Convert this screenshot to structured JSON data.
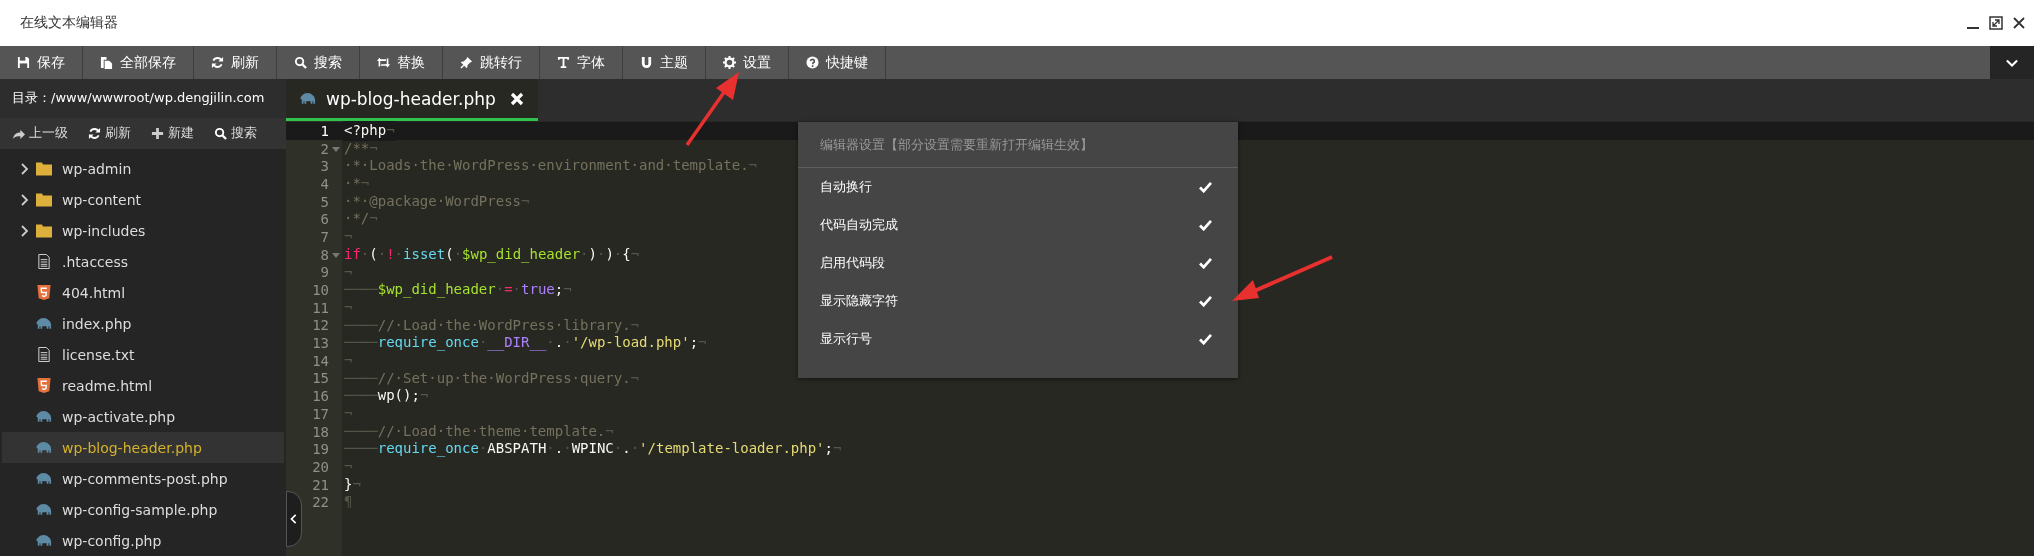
{
  "window": {
    "title": "在线文本编辑器"
  },
  "toolbar": [
    "保存",
    "全部保存",
    "刷新",
    "搜索",
    "替换",
    "跳转行",
    "字体",
    "主题",
    "设置",
    "快捷键"
  ],
  "sidebar": {
    "path": "目录：/www/wwwroot/wp.dengjilin.com",
    "tools": [
      "上一级",
      "刷新",
      "新建",
      "搜索"
    ],
    "files": [
      {
        "name": "wp-admin",
        "kind": "folder",
        "selected": false
      },
      {
        "name": "wp-content",
        "kind": "folder",
        "selected": false
      },
      {
        "name": "wp-includes",
        "kind": "folder",
        "selected": false
      },
      {
        "name": ".htaccess",
        "kind": "text",
        "selected": false
      },
      {
        "name": "404.html",
        "kind": "html",
        "selected": false
      },
      {
        "name": "index.php",
        "kind": "php",
        "selected": false
      },
      {
        "name": "license.txt",
        "kind": "text",
        "selected": false
      },
      {
        "name": "readme.html",
        "kind": "html",
        "selected": false
      },
      {
        "name": "wp-activate.php",
        "kind": "php",
        "selected": false
      },
      {
        "name": "wp-blog-header.php",
        "kind": "php",
        "selected": true
      },
      {
        "name": "wp-comments-post.php",
        "kind": "php",
        "selected": false
      },
      {
        "name": "wp-config-sample.php",
        "kind": "php",
        "selected": false
      },
      {
        "name": "wp-config.php",
        "kind": "php",
        "selected": false
      }
    ]
  },
  "tabs": [
    {
      "label": "wp-blog-header.php",
      "selected": true
    }
  ],
  "editor": {
    "lines": [
      {
        "n": "1",
        "current": true,
        "foldable": false,
        "tokens": [
          {
            "kind": "plain",
            "text": "<?php"
          },
          {
            "kind": "inv",
            "text": "¬"
          }
        ]
      },
      {
        "n": "2",
        "current": false,
        "foldable": true,
        "tokens": [
          {
            "kind": "comment",
            "text": "/**"
          },
          {
            "kind": "inv",
            "text": "¬"
          }
        ]
      },
      {
        "n": "3",
        "current": false,
        "foldable": false,
        "tokens": [
          {
            "kind": "comment",
            "text": "·*·Loads·the·WordPress·environment·and·template."
          },
          {
            "kind": "inv",
            "text": "¬"
          }
        ]
      },
      {
        "n": "4",
        "current": false,
        "foldable": false,
        "tokens": [
          {
            "kind": "comment",
            "text": "·*"
          },
          {
            "kind": "inv",
            "text": "¬"
          }
        ]
      },
      {
        "n": "5",
        "current": false,
        "foldable": false,
        "tokens": [
          {
            "kind": "comment",
            "text": "·*·@package·WordPress"
          },
          {
            "kind": "inv",
            "text": "¬"
          }
        ]
      },
      {
        "n": "6",
        "current": false,
        "foldable": false,
        "tokens": [
          {
            "kind": "comment",
            "text": "·*/"
          },
          {
            "kind": "inv",
            "text": "¬"
          }
        ]
      },
      {
        "n": "7",
        "current": false,
        "foldable": false,
        "tokens": [
          {
            "kind": "inv",
            "text": "¬"
          }
        ]
      },
      {
        "n": "8",
        "current": false,
        "foldable": true,
        "tokens": [
          {
            "kind": "kw",
            "text": "if"
          },
          {
            "kind": "inv",
            "text": "·"
          },
          {
            "kind": "plain",
            "text": "("
          },
          {
            "kind": "inv",
            "text": "·"
          },
          {
            "kind": "kw",
            "text": "!"
          },
          {
            "kind": "inv",
            "text": "·"
          },
          {
            "kind": "func",
            "text": "isset"
          },
          {
            "kind": "plain",
            "text": "("
          },
          {
            "kind": "inv",
            "text": "·"
          },
          {
            "kind": "var",
            "text": "$wp_did_header"
          },
          {
            "kind": "inv",
            "text": "·"
          },
          {
            "kind": "plain",
            "text": ")"
          },
          {
            "kind": "inv",
            "text": "·"
          },
          {
            "kind": "plain",
            "text": ")"
          },
          {
            "kind": "inv",
            "text": "·"
          },
          {
            "kind": "plain",
            "text": "{"
          },
          {
            "kind": "inv",
            "text": "¬"
          }
        ]
      },
      {
        "n": "9",
        "current": false,
        "foldable": false,
        "tokens": [
          {
            "kind": "inv",
            "text": "¬"
          }
        ]
      },
      {
        "n": "10",
        "current": false,
        "foldable": false,
        "tokens": [
          {
            "kind": "inv",
            "text": "────"
          },
          {
            "kind": "var",
            "text": "$wp_did_header"
          },
          {
            "kind": "inv",
            "text": "·"
          },
          {
            "kind": "kw",
            "text": "="
          },
          {
            "kind": "inv",
            "text": "·"
          },
          {
            "kind": "const",
            "text": "true"
          },
          {
            "kind": "plain",
            "text": ";"
          },
          {
            "kind": "inv",
            "text": "¬"
          }
        ]
      },
      {
        "n": "11",
        "current": false,
        "foldable": false,
        "tokens": [
          {
            "kind": "inv",
            "text": "¬"
          }
        ]
      },
      {
        "n": "12",
        "current": false,
        "foldable": false,
        "tokens": [
          {
            "kind": "inv",
            "text": "────"
          },
          {
            "kind": "comment",
            "text": "//·Load·the·WordPress·library."
          },
          {
            "kind": "inv",
            "text": "¬"
          }
        ]
      },
      {
        "n": "13",
        "current": false,
        "foldable": false,
        "tokens": [
          {
            "kind": "inv",
            "text": "────"
          },
          {
            "kind": "func",
            "text": "require_once"
          },
          {
            "kind": "inv",
            "text": "·"
          },
          {
            "kind": "const",
            "text": "__DIR__"
          },
          {
            "kind": "inv",
            "text": "·"
          },
          {
            "kind": "plain",
            "text": "."
          },
          {
            "kind": "inv",
            "text": "·"
          },
          {
            "kind": "str",
            "text": "'/wp-load.php'"
          },
          {
            "kind": "plain",
            "text": ";"
          },
          {
            "kind": "inv",
            "text": "¬"
          }
        ]
      },
      {
        "n": "14",
        "current": false,
        "foldable": false,
        "tokens": [
          {
            "kind": "inv",
            "text": "¬"
          }
        ]
      },
      {
        "n": "15",
        "current": false,
        "foldable": false,
        "tokens": [
          {
            "kind": "inv",
            "text": "────"
          },
          {
            "kind": "comment",
            "text": "//·Set·up·the·WordPress·query."
          },
          {
            "kind": "inv",
            "text": "¬"
          }
        ]
      },
      {
        "n": "16",
        "current": false,
        "foldable": false,
        "tokens": [
          {
            "kind": "inv",
            "text": "────"
          },
          {
            "kind": "plain",
            "text": "wp();"
          },
          {
            "kind": "inv",
            "text": "¬"
          }
        ]
      },
      {
        "n": "17",
        "current": false,
        "foldable": false,
        "tokens": [
          {
            "kind": "inv",
            "text": "¬"
          }
        ]
      },
      {
        "n": "18",
        "current": false,
        "foldable": false,
        "tokens": [
          {
            "kind": "inv",
            "text": "────"
          },
          {
            "kind": "comment",
            "text": "//·Load·the·theme·template."
          },
          {
            "kind": "inv",
            "text": "¬"
          }
        ]
      },
      {
        "n": "19",
        "current": false,
        "foldable": false,
        "tokens": [
          {
            "kind": "inv",
            "text": "────"
          },
          {
            "kind": "func",
            "text": "require_once"
          },
          {
            "kind": "inv",
            "text": "·"
          },
          {
            "kind": "plain",
            "text": "ABSPATH"
          },
          {
            "kind": "inv",
            "text": "·"
          },
          {
            "kind": "plain",
            "text": "."
          },
          {
            "kind": "inv",
            "text": "·"
          },
          {
            "kind": "plain",
            "text": "WPINC"
          },
          {
            "kind": "inv",
            "text": "·"
          },
          {
            "kind": "plain",
            "text": "."
          },
          {
            "kind": "inv",
            "text": "·"
          },
          {
            "kind": "str",
            "text": "'/template-loader.php'"
          },
          {
            "kind": "plain",
            "text": ";"
          },
          {
            "kind": "inv",
            "text": "¬"
          }
        ]
      },
      {
        "n": "20",
        "current": false,
        "foldable": false,
        "tokens": [
          {
            "kind": "inv",
            "text": "¬"
          }
        ]
      },
      {
        "n": "21",
        "current": false,
        "foldable": false,
        "tokens": [
          {
            "kind": "plain",
            "text": "}"
          },
          {
            "kind": "inv",
            "text": "¬"
          }
        ]
      },
      {
        "n": "22",
        "current": false,
        "foldable": false,
        "tokens": [
          {
            "kind": "inv",
            "text": "¶"
          }
        ]
      }
    ]
  },
  "settings_menu": {
    "header": "编辑器设置【部分设置需要重新打开编辑生效】",
    "items": [
      {
        "label": "自动换行",
        "checked": true
      },
      {
        "label": "代码自动完成",
        "checked": true
      },
      {
        "label": "启用代码段",
        "checked": true
      },
      {
        "label": "显示隐藏字符",
        "checked": true
      },
      {
        "label": "显示行号",
        "checked": true
      }
    ]
  }
}
